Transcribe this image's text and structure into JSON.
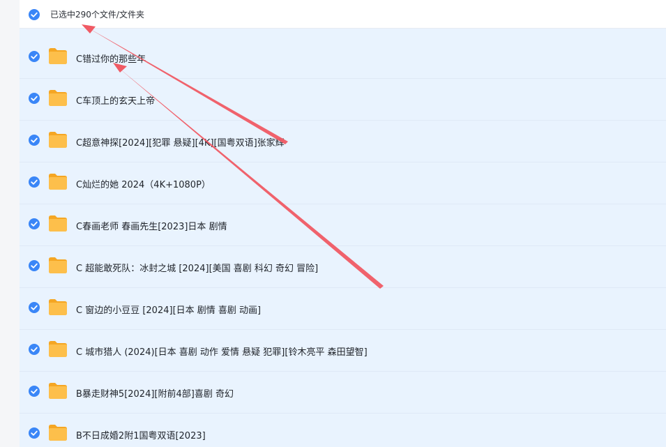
{
  "header": {
    "selection_text": "已选中290个文件/文件夹"
  },
  "rows": [
    {
      "name": "C错过你的那些年"
    },
    {
      "name": "C车顶上的玄天上帝"
    },
    {
      "name": "C超意神探[2024][犯罪 悬疑][4K][国粤双语]张家辉"
    },
    {
      "name": "C灿烂的她 2024（4K+1080P）"
    },
    {
      "name": "C春画老师 春画先生[2023]日本 剧情"
    },
    {
      "name": "C 超能敢死队：冰封之城 [2024][美国 喜剧 科幻 奇幻 冒险]"
    },
    {
      "name": "C 窗边的小豆豆 [2024][日本 剧情 喜剧 动画]"
    },
    {
      "name": "C 城市猎人 (2024)[日本 喜剧 动作 爱情 悬疑 犯罪][铃木亮平 森田望智]"
    },
    {
      "name": "B暴走财神5[2024][附前4部]喜剧 奇幻"
    },
    {
      "name": "B不日成婚2附1国粤双语[2023]"
    }
  ],
  "icons": {
    "checkbox": "checked-circle-icon",
    "folder": "folder-icon"
  },
  "colors": {
    "accent": "#3a86f7",
    "folder": "#fdbf4b",
    "list_background": "#e9f3fe",
    "annotation_arrow": "#f05a64"
  }
}
